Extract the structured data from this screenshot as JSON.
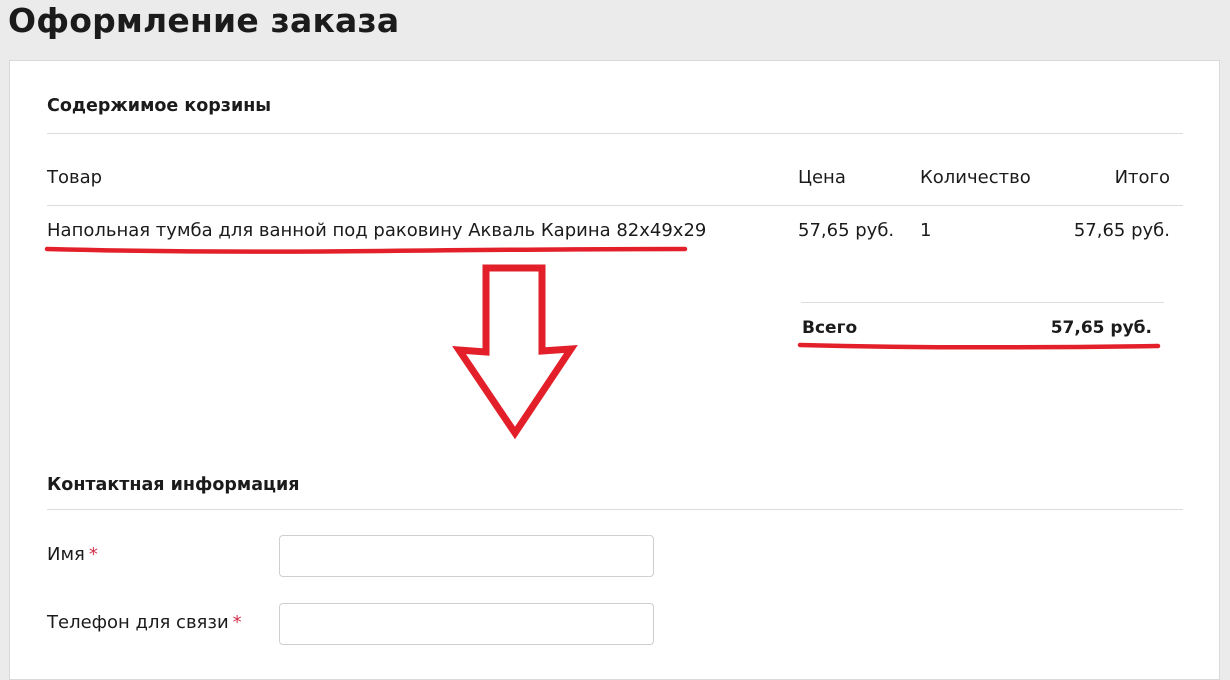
{
  "page": {
    "title": "Оформление заказа"
  },
  "cart": {
    "heading": "Содержимое корзины",
    "columns": {
      "product": "Товар",
      "price": "Цена",
      "quantity": "Количество",
      "total": "Итого"
    },
    "items": [
      {
        "product": "Напольная тумба для ванной под раковину Акваль Карина 82x49x29",
        "price": "57,65 руб.",
        "quantity": "1",
        "total": "57,65 руб."
      }
    ],
    "grand_total": {
      "label": "Всего",
      "value": "57,65 руб."
    }
  },
  "contact": {
    "heading": "Контактная информация",
    "fields": [
      {
        "label": "Имя",
        "required_mark": "*",
        "value": ""
      },
      {
        "label": "Телефон для связи",
        "required_mark": "*",
        "value": ""
      }
    ]
  },
  "annotations": {
    "color": "#e3202a",
    "icon": "down-arrow-outline"
  }
}
